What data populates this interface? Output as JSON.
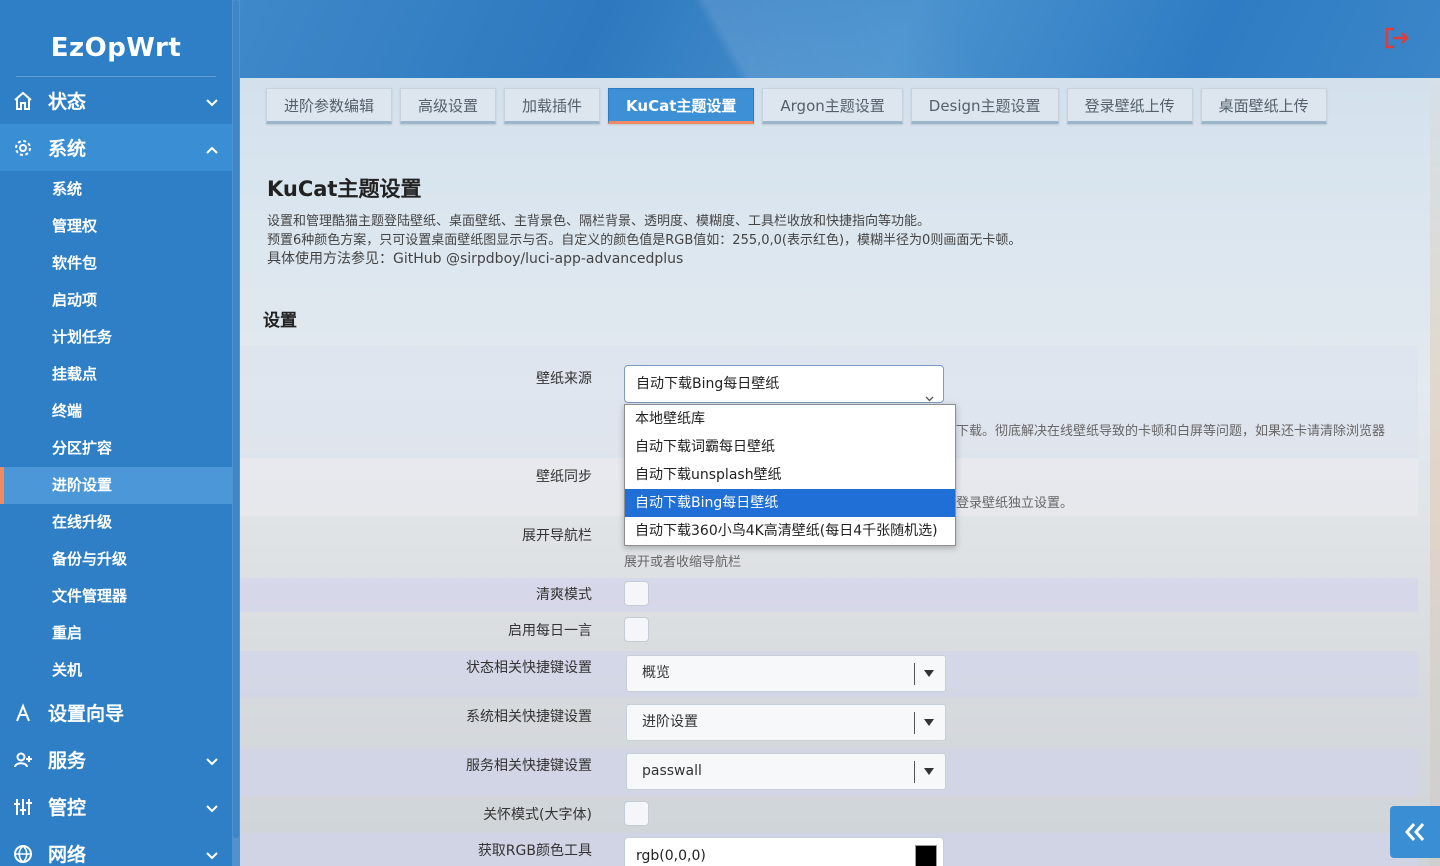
{
  "brand": "EzOpWrt",
  "header": {
    "logout_icon": "logout-icon",
    "accent": "#e53935"
  },
  "sidebar": {
    "groups": [
      {
        "label": "状态",
        "icon": "home-icon",
        "expanded": false
      },
      {
        "label": "系统",
        "icon": "gear-icon",
        "expanded": true
      },
      {
        "label": "设置向导",
        "icon": "wizard-icon",
        "expanded": false
      },
      {
        "label": "服务",
        "icon": "user-plus-icon",
        "expanded": false
      },
      {
        "label": "管控",
        "icon": "sliders-icon",
        "expanded": false
      },
      {
        "label": "网络",
        "icon": "globe-icon",
        "expanded": false
      }
    ],
    "system_items": [
      "系统",
      "管理权",
      "软件包",
      "启动项",
      "计划任务",
      "挂载点",
      "终端",
      "分区扩容",
      "进阶设置",
      "在线升级",
      "备份与升级",
      "文件管理器",
      "重启",
      "关机"
    ],
    "selected_item": "进阶设置"
  },
  "tabs": [
    "进阶参数编辑",
    "高级设置",
    "加载插件",
    "KuCat主题设置",
    "Argon主题设置",
    "Design主题设置",
    "登录壁纸上传",
    "桌面壁纸上传"
  ],
  "active_tab": "KuCat主题设置",
  "page": {
    "title": "KuCat主题设置",
    "desc_line1": "设置和管理酷猫主题登陆壁纸、桌面壁纸、主背景色、隔栏背景、透明度、模糊度、工具栏收放和快捷指向等功能。",
    "desc_line2": "预置6种颜色方案，只可设置桌面壁纸图显示与否。自定义的颜色值是RGB值如：255,0,0(表示红色)，模糊半径为0则画面无卡顿。",
    "desc_line3": "具体使用方法参见：GitHub @sirpdboy/luci-app-advancedplus",
    "section": "设置"
  },
  "form": {
    "wallpaper_source": {
      "label": "壁纸来源",
      "value": "自动下载Bing每日壁纸",
      "options": [
        "本地壁纸库",
        "自动下载词霸每日壁纸",
        "自动下载unsplash壁纸",
        "自动下载Bing每日壁纸",
        "自动下载360小鸟4K高清壁纸(每日4千张随机选)"
      ],
      "hint_visible": "下载。彻底解决在线壁纸导致的卡顿和白屏等问题，如果还卡请清除浏览器"
    },
    "wallpaper_sync": {
      "label": "壁纸同步",
      "hint_visible": "登录壁纸独立设置。"
    },
    "expand_nav": {
      "label": "展开导航栏",
      "hint": "展开或者收缩导航栏"
    },
    "fresh_mode": {
      "label": "清爽模式",
      "checked": false
    },
    "daily_quote": {
      "label": "启用每日一言",
      "checked": false
    },
    "status_shortcut": {
      "label": "状态相关快捷键设置",
      "value": "概览"
    },
    "system_shortcut": {
      "label": "系统相关快捷键设置",
      "value": "进阶设置"
    },
    "service_shortcut": {
      "label": "服务相关快捷键设置",
      "value": "passwall"
    },
    "care_mode": {
      "label": "关怀模式(大字体)",
      "checked": false
    },
    "rgb_tool": {
      "label": "获取RGB颜色工具",
      "value": "rgb(0,0,0)",
      "swatch_color": "#000000"
    }
  },
  "colors": {
    "sidebar_bg": "#2e7fc6",
    "active_tab": "#3d8fd6",
    "accent_orange": "#f08a64",
    "dropdown_highlight": "#1f6fd6"
  }
}
